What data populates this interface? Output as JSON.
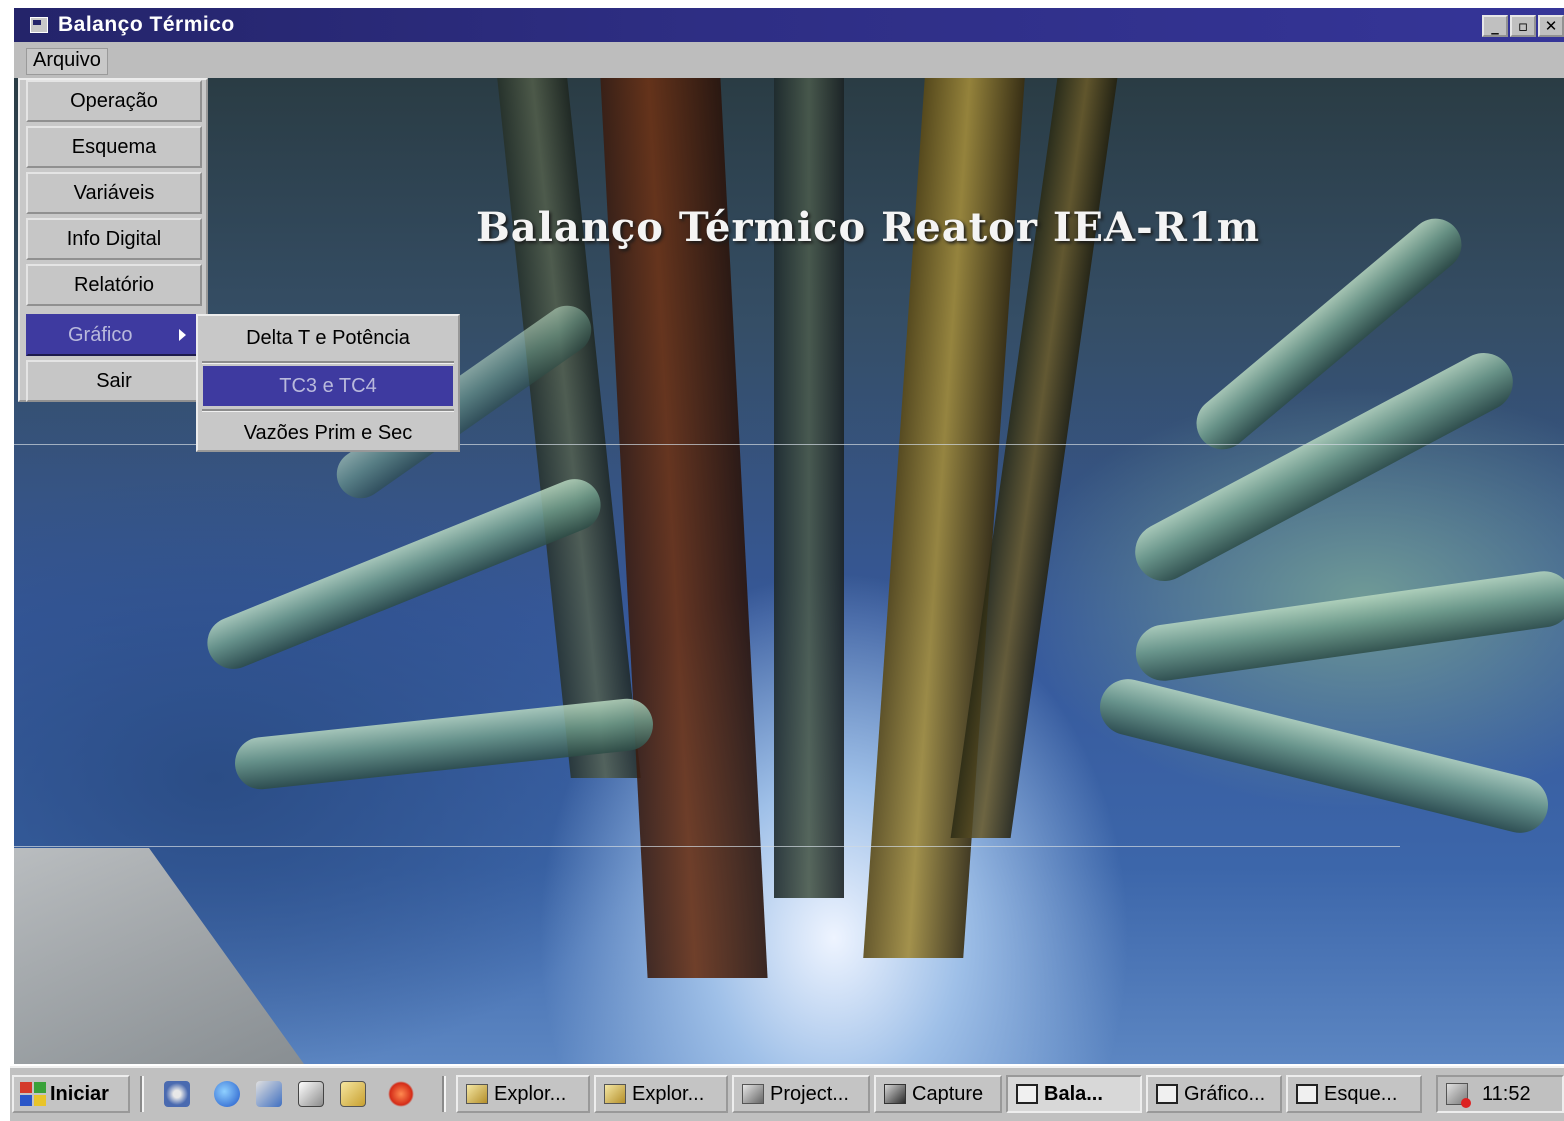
{
  "window": {
    "title": "Balanço Térmico",
    "buttons": {
      "minimize": "_",
      "restore": "▫",
      "close": "✕"
    }
  },
  "menubar": {
    "arquivo": "Arquivo"
  },
  "main_title": "Balanço Térmico Reator IEA-R1m",
  "arquivo_menu": {
    "items": [
      {
        "label": "Operação"
      },
      {
        "label": "Esquema"
      },
      {
        "label": "Variáveis"
      },
      {
        "label": "Info Digital"
      },
      {
        "label": "Relatório"
      },
      {
        "label": "Gráfico",
        "selected": true,
        "has_submenu": true
      },
      {
        "label": "Sair"
      }
    ]
  },
  "grafico_submenu": {
    "items": [
      {
        "label": "Delta T e Potência"
      },
      {
        "label": "TC3 e TC4",
        "selected": true
      },
      {
        "label": "Vazões Prim e Sec"
      }
    ]
  },
  "taskbar": {
    "start_label": "Iniciar",
    "quick_launch": [
      "satellite-icon",
      "internet-explorer-icon",
      "network-icon",
      "edit-icon",
      "find-icon",
      "star-icon"
    ],
    "tasks": [
      {
        "label": "Explor..."
      },
      {
        "label": "Explor..."
      },
      {
        "label": "Project..."
      },
      {
        "label": "Capture"
      },
      {
        "label": "Bala...",
        "active": true
      },
      {
        "label": "Gráfico..."
      },
      {
        "label": "Esque..."
      }
    ],
    "clock": "11:52"
  },
  "colors": {
    "titlebar": "#2e2e84",
    "menu_highlight": "#3e3aa0",
    "menu_face": "#c8c8c8"
  }
}
